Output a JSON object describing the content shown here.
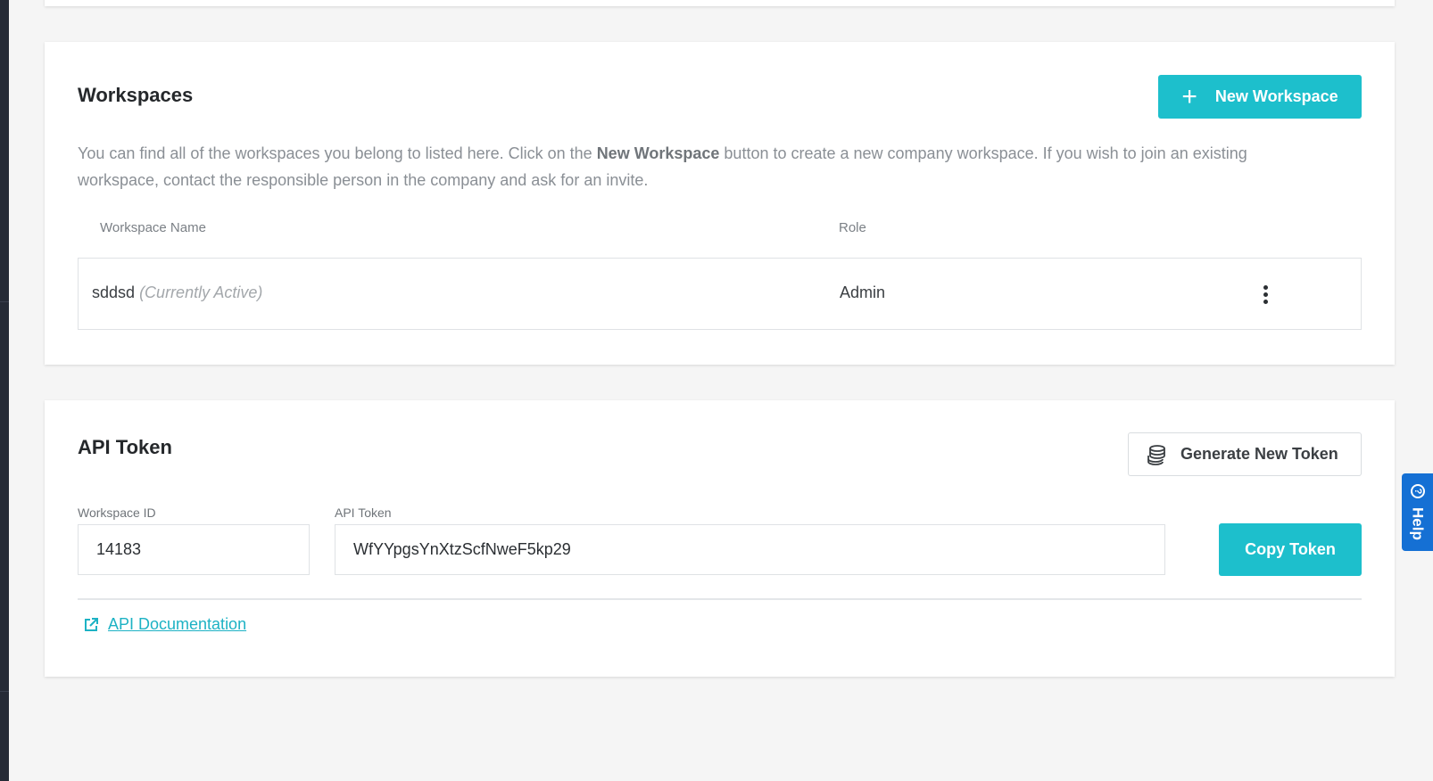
{
  "workspaces": {
    "title": "Workspaces",
    "new_button_label": "New Workspace",
    "description_before": "You can find all of the workspaces you belong to listed here. Click on the ",
    "description_bold": "New Workspace",
    "description_after": " button to create a new company workspace. If you wish to join an existing workspace, contact the responsible person in the company and ask for an invite.",
    "columns": {
      "name": "Workspace Name",
      "role": "Role"
    },
    "rows": [
      {
        "name": "sddsd",
        "status": "(Currently Active)",
        "role": "Admin"
      }
    ]
  },
  "api_token": {
    "title": "API Token",
    "generate_button_label": "Generate New Token",
    "workspace_id_label": "Workspace ID",
    "workspace_id_value": "14183",
    "token_label": "API Token",
    "token_value": "WfYYpgsYnXtzScfNweF5kp29",
    "copy_button_label": "Copy Token",
    "doc_link_label": "API Documentation"
  },
  "help": {
    "label": "Help"
  },
  "colors": {
    "accent": "#1dbfcc",
    "help": "#1570d4",
    "link": "#1db2c4"
  }
}
